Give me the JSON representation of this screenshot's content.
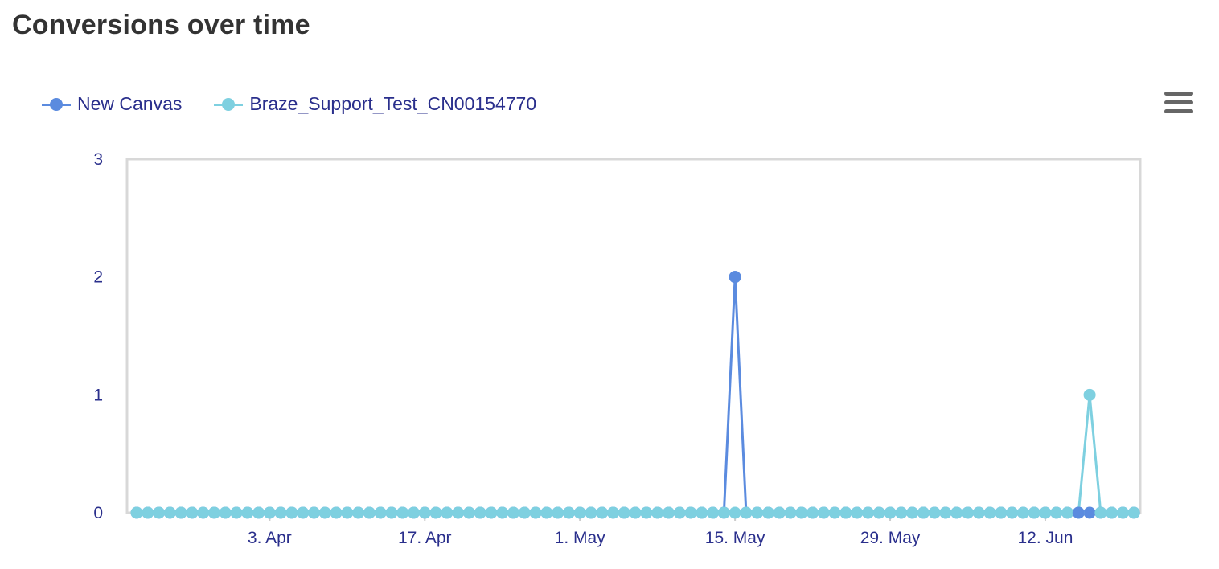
{
  "title": "Conversions over time",
  "menu_icon": "hamburger-menu-icon",
  "colors": {
    "series_a": "#5b8bdf",
    "series_b": "#7ed0e0",
    "axis_text": "#2a2f8c",
    "plot_border": "#d8d8d8",
    "title": "#333333"
  },
  "chart_data": {
    "type": "line",
    "title": "Conversions over time",
    "xlabel": "",
    "ylabel": "",
    "x_start": "2023-03-22",
    "x_ticks": [
      "3. Apr",
      "17. Apr",
      "1. May",
      "15. May",
      "29. May",
      "12. Jun"
    ],
    "y_ticks": [
      "0",
      "1",
      "2",
      "3"
    ],
    "ylim": [
      0,
      3
    ],
    "grid": false,
    "legend_position": "top-left",
    "series": [
      {
        "name": "New Canvas",
        "color": "#5b8bdf",
        "values": [
          0,
          0,
          0,
          0,
          0,
          0,
          0,
          0,
          0,
          0,
          0,
          0,
          0,
          0,
          0,
          0,
          0,
          0,
          0,
          0,
          0,
          0,
          0,
          0,
          0,
          0,
          0,
          0,
          0,
          0,
          0,
          0,
          0,
          0,
          0,
          0,
          0,
          0,
          0,
          0,
          0,
          0,
          0,
          0,
          0,
          0,
          0,
          0,
          0,
          0,
          0,
          0,
          0,
          0,
          2,
          0,
          0,
          0,
          0,
          0,
          0,
          0,
          0,
          0,
          0,
          0,
          0,
          0,
          0,
          0,
          0,
          0,
          0,
          0,
          0,
          0,
          0,
          0,
          0,
          0,
          0,
          0,
          0,
          0,
          0,
          0,
          0,
          0,
          0,
          0,
          0
        ]
      },
      {
        "name": "Braze_Support_Test_CN00154770",
        "color": "#7ed0e0",
        "values": [
          0,
          0,
          0,
          0,
          0,
          0,
          0,
          0,
          0,
          0,
          0,
          0,
          0,
          0,
          0,
          0,
          0,
          0,
          0,
          0,
          0,
          0,
          0,
          0,
          0,
          0,
          0,
          0,
          0,
          0,
          0,
          0,
          0,
          0,
          0,
          0,
          0,
          0,
          0,
          0,
          0,
          0,
          0,
          0,
          0,
          0,
          0,
          0,
          0,
          0,
          0,
          0,
          0,
          0,
          0,
          0,
          0,
          0,
          0,
          0,
          0,
          0,
          0,
          0,
          0,
          0,
          0,
          0,
          0,
          0,
          0,
          0,
          0,
          0,
          0,
          0,
          0,
          0,
          0,
          0,
          0,
          0,
          0,
          0,
          0,
          0,
          1,
          0,
          0,
          0,
          0
        ]
      }
    ]
  }
}
